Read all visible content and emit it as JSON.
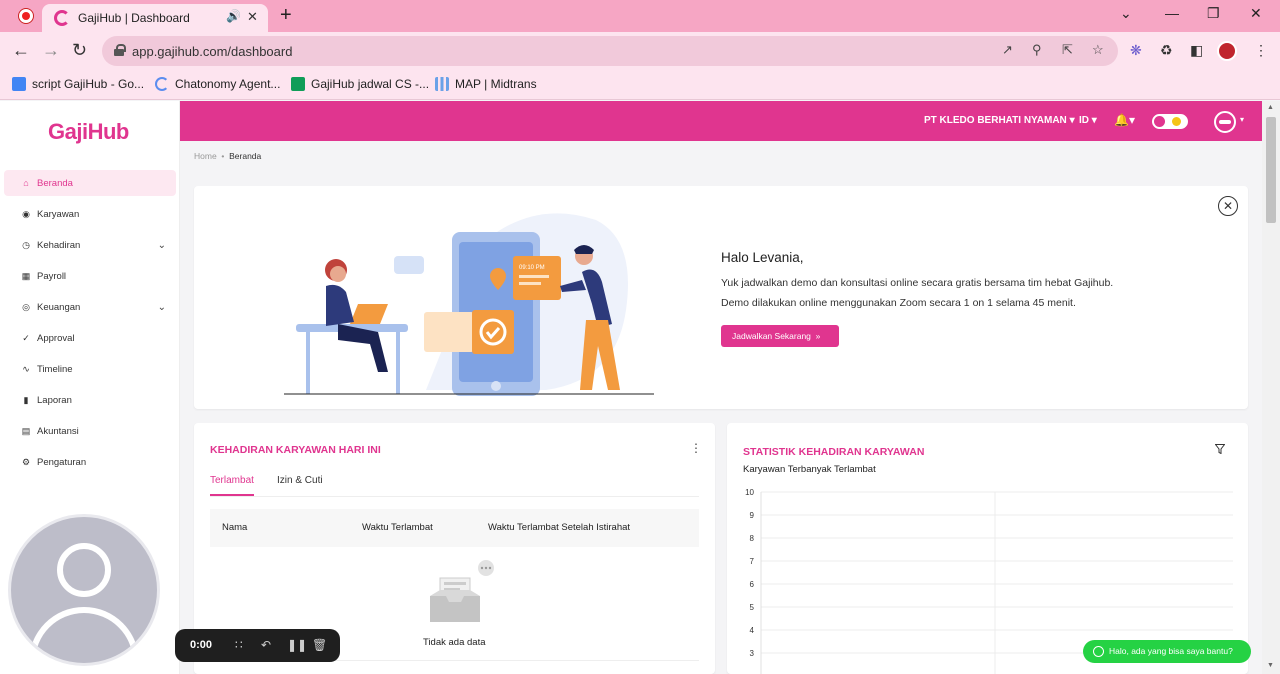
{
  "browser": {
    "tab_title": "GajiHub | Dashboard",
    "new_tab": "+",
    "url": "app.gajihub.com/dashboard",
    "bookmarks": [
      {
        "label": "script GajiHub - Go...",
        "color": "#4285f4"
      },
      {
        "label": "Chatonomy Agent...",
        "color": "#5b8def"
      },
      {
        "label": "GajiHub jadwal CS -...",
        "color": "#0f9d58"
      },
      {
        "label": "MAP | Midtrans",
        "color": "#6aa1e8"
      }
    ]
  },
  "app": {
    "logo": "GajiHub",
    "brand_color": "#e0358f",
    "company": "PT KLEDO BERHATI NYAMAN",
    "language": "ID",
    "breadcrumb": {
      "home": "Home",
      "current": "Beranda"
    },
    "sidebar": [
      {
        "label": "Beranda",
        "icon": "home-icon",
        "active": true
      },
      {
        "label": "Karyawan",
        "icon": "employee-icon"
      },
      {
        "label": "Kehadiran",
        "icon": "attendance-icon",
        "expandable": true
      },
      {
        "label": "Payroll",
        "icon": "payroll-icon"
      },
      {
        "label": "Keuangan",
        "icon": "finance-icon",
        "expandable": true
      },
      {
        "label": "Approval",
        "icon": "approval-icon"
      },
      {
        "label": "Timeline",
        "icon": "timeline-icon"
      },
      {
        "label": "Laporan",
        "icon": "report-icon"
      },
      {
        "label": "Akuntansi",
        "icon": "accounting-icon"
      },
      {
        "label": "Pengaturan",
        "icon": "settings-icon"
      }
    ]
  },
  "banner": {
    "greeting": "Halo Levania,",
    "line1": "Yuk jadwalkan demo dan konsultasi online secara gratis bersama tim hebat Gajihub.",
    "line2": "Demo dilakukan online menggunakan Zoom secara 1 on 1 selama 45 menit.",
    "cta": "Jadwalkan Sekarang",
    "illustration_time": "09:10 PM"
  },
  "attendance": {
    "title": "KEHADIRAN KARYAWAN HARI INI",
    "tabs": [
      "Terlambat",
      "Izin & Cuti"
    ],
    "active_tab": "Terlambat",
    "columns": [
      "Nama",
      "Waktu Terlambat",
      "Waktu Terlambat Setelah Istirahat"
    ],
    "empty": "Tidak ada data"
  },
  "statistics": {
    "title": "STATISTIK KEHADIRAN KARYAWAN",
    "subtitle": "Karyawan Terbanyak Terlambat"
  },
  "chart_data": {
    "type": "bar",
    "title": "Karyawan Terbanyak Terlambat",
    "categories": [],
    "values": [],
    "ylim": [
      0,
      10
    ],
    "yticks": [
      "10",
      "9",
      "8",
      "7",
      "6",
      "5",
      "4",
      "3"
    ],
    "grid": true
  },
  "recorder": {
    "time": "0:00"
  },
  "chat": {
    "label": "Halo, ada yang bisa saya bantu?"
  }
}
